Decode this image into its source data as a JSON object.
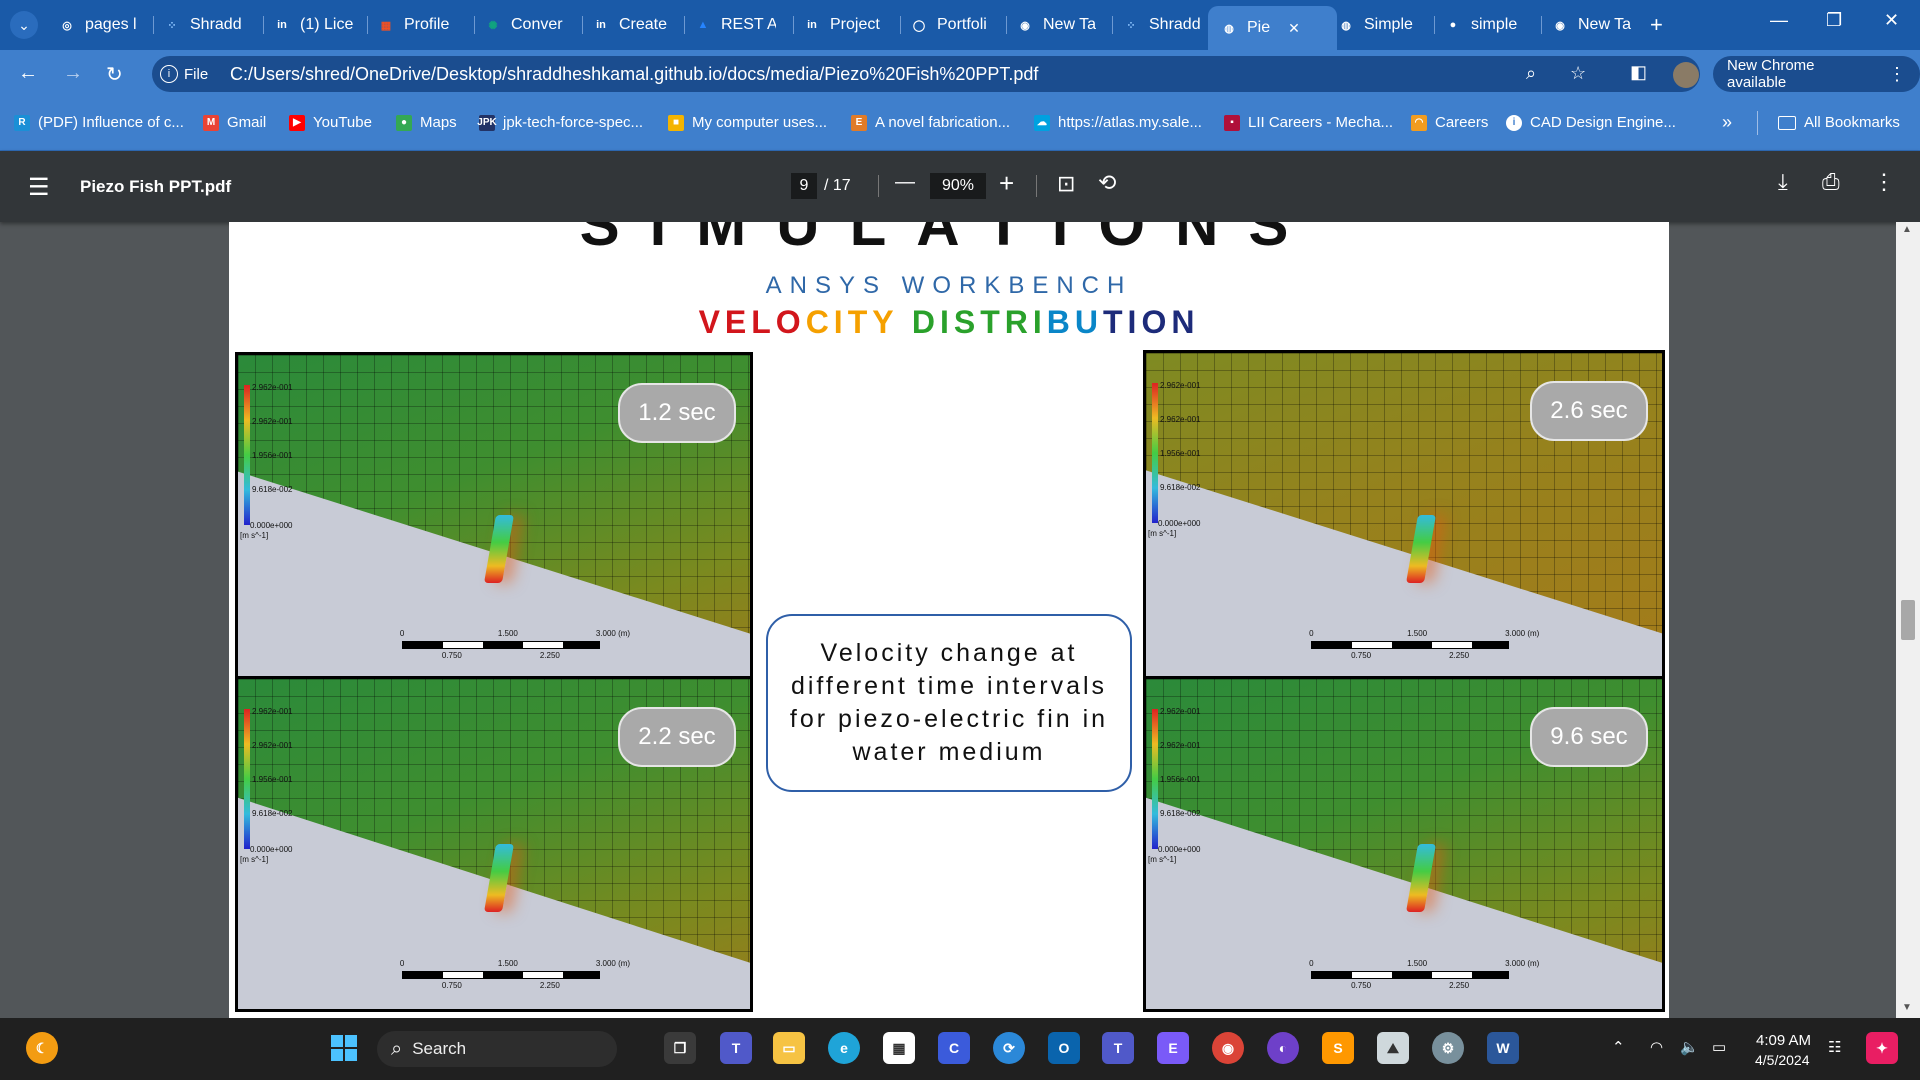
{
  "browser": {
    "tabs": [
      {
        "label": "pages l",
        "icon": "copilot-icon",
        "active": false
      },
      {
        "label": "Shradd",
        "icon": "dots-icon",
        "active": false
      },
      {
        "label": "(1) Lice",
        "icon": "linkedin-icon",
        "active": false
      },
      {
        "label": "Profile",
        "icon": "microsoft-icon",
        "active": false
      },
      {
        "label": "Conver",
        "icon": "chatgpt-icon",
        "active": false
      },
      {
        "label": "Create",
        "icon": "linkedin-icon",
        "active": false
      },
      {
        "label": "REST A",
        "icon": "atlassian-icon",
        "active": false
      },
      {
        "label": "Project",
        "icon": "linkedin-icon",
        "active": false
      },
      {
        "label": "Portfoli",
        "icon": "circle-icon",
        "active": false
      },
      {
        "label": "New Ta",
        "icon": "chrome-icon",
        "active": false
      },
      {
        "label": "Shradd",
        "icon": "dots-icon",
        "active": false
      },
      {
        "label": "Pie",
        "icon": "globe-icon",
        "active": true
      },
      {
        "label": "Simple",
        "icon": "globe-icon",
        "active": false
      },
      {
        "label": "simple",
        "icon": "github-icon",
        "active": false
      },
      {
        "label": "New Ta",
        "icon": "chrome-icon",
        "active": false
      }
    ],
    "new_tab_symbol": "+",
    "tab_close_symbol": "✕",
    "window_controls": {
      "minimize": "—",
      "restore": "❐",
      "close": "✕"
    },
    "address": {
      "scheme_chip": "File",
      "url": "C:/Users/shred/OneDrive/Desktop/shraddheshkamal.github.io/docs/media/Piezo%20Fish%20PPT.pdf"
    },
    "update_button": "New Chrome available",
    "bookmarks": [
      {
        "label": "(PDF) Influence of c...",
        "color": "#1b8fd6",
        "glyph": "R"
      },
      {
        "label": "Gmail",
        "color": "#ea4335",
        "glyph": "M"
      },
      {
        "label": "YouTube",
        "color": "#ff0000",
        "glyph": "▶"
      },
      {
        "label": "Maps",
        "color": "#34a853",
        "glyph": "●"
      },
      {
        "label": "jpk-tech-force-spec...",
        "color": "#223366",
        "glyph": "JPK"
      },
      {
        "label": "My computer uses...",
        "color": "#f4b400",
        "glyph": "■"
      },
      {
        "label": "A novel fabrication...",
        "color": "#e07b28",
        "glyph": "E"
      },
      {
        "label": "https://atlas.my.sale...",
        "color": "#00a1e0",
        "glyph": "☁"
      },
      {
        "label": "LII Careers - Mecha...",
        "color": "#b0103a",
        "glyph": "▪"
      },
      {
        "label": "Careers",
        "color": "#f29c1f",
        "glyph": "◠"
      },
      {
        "label": "CAD Design Engine...",
        "color": "#ffffff",
        "glyph": "i"
      }
    ],
    "bookmarks_overflow": "»",
    "all_bookmarks": "All Bookmarks"
  },
  "pdf": {
    "filename": "Piezo Fish PPT.pdf",
    "current_page": "9",
    "total_pages": "/ 17",
    "zoom": "90%",
    "zoom_out": "—",
    "zoom_in": "+"
  },
  "slide": {
    "title": "SIMULATIONS",
    "subtitle": "ANSYS WORKBENCH",
    "velocity_letters": [
      {
        "ch": "V",
        "color": "#d2161c"
      },
      {
        "ch": "E",
        "color": "#d2161c"
      },
      {
        "ch": "L",
        "color": "#d2161c"
      },
      {
        "ch": "O",
        "color": "#d2161c"
      },
      {
        "ch": "C",
        "color": "#f5a000"
      },
      {
        "ch": "I",
        "color": "#f5a000"
      },
      {
        "ch": "T",
        "color": "#f5a000"
      },
      {
        "ch": "Y",
        "color": "#f5a000"
      },
      {
        "ch": " ",
        "color": "#ffffff"
      },
      {
        "ch": "D",
        "color": "#2aa12b"
      },
      {
        "ch": "I",
        "color": "#2aa12b"
      },
      {
        "ch": "S",
        "color": "#2aa12b"
      },
      {
        "ch": "T",
        "color": "#2aa12b"
      },
      {
        "ch": "R",
        "color": "#2aa12b"
      },
      {
        "ch": "I",
        "color": "#2aa12b"
      },
      {
        "ch": "B",
        "color": "#0a86c8"
      },
      {
        "ch": "U",
        "color": "#0a86c8"
      },
      {
        "ch": "T",
        "color": "#1d2b7a"
      },
      {
        "ch": "I",
        "color": "#1d2b7a"
      },
      {
        "ch": "O",
        "color": "#1d2b7a"
      },
      {
        "ch": "N",
        "color": "#1d2b7a"
      }
    ],
    "caption": "Velocity change at different time intervals for piezo-electric fin in water medium",
    "simulations": [
      {
        "time": "1.2 sec"
      },
      {
        "time": "2.2 sec"
      },
      {
        "time": "2.6 sec"
      },
      {
        "time": "9.6 sec"
      }
    ],
    "legend_values": [
      "2.962e-001",
      "2.962e-001",
      "1.956e-001",
      "9.618e-002",
      "0.000e+000"
    ],
    "legend_unit": "[m s^-1]",
    "scale_ticks_top": [
      "0",
      "1.500",
      "3.000 (m)"
    ],
    "scale_ticks_bottom": [
      "0.750",
      "2.250"
    ]
  },
  "taskbar": {
    "search_label": "Search",
    "time": "4:09 AM",
    "date": "4/5/2024"
  }
}
